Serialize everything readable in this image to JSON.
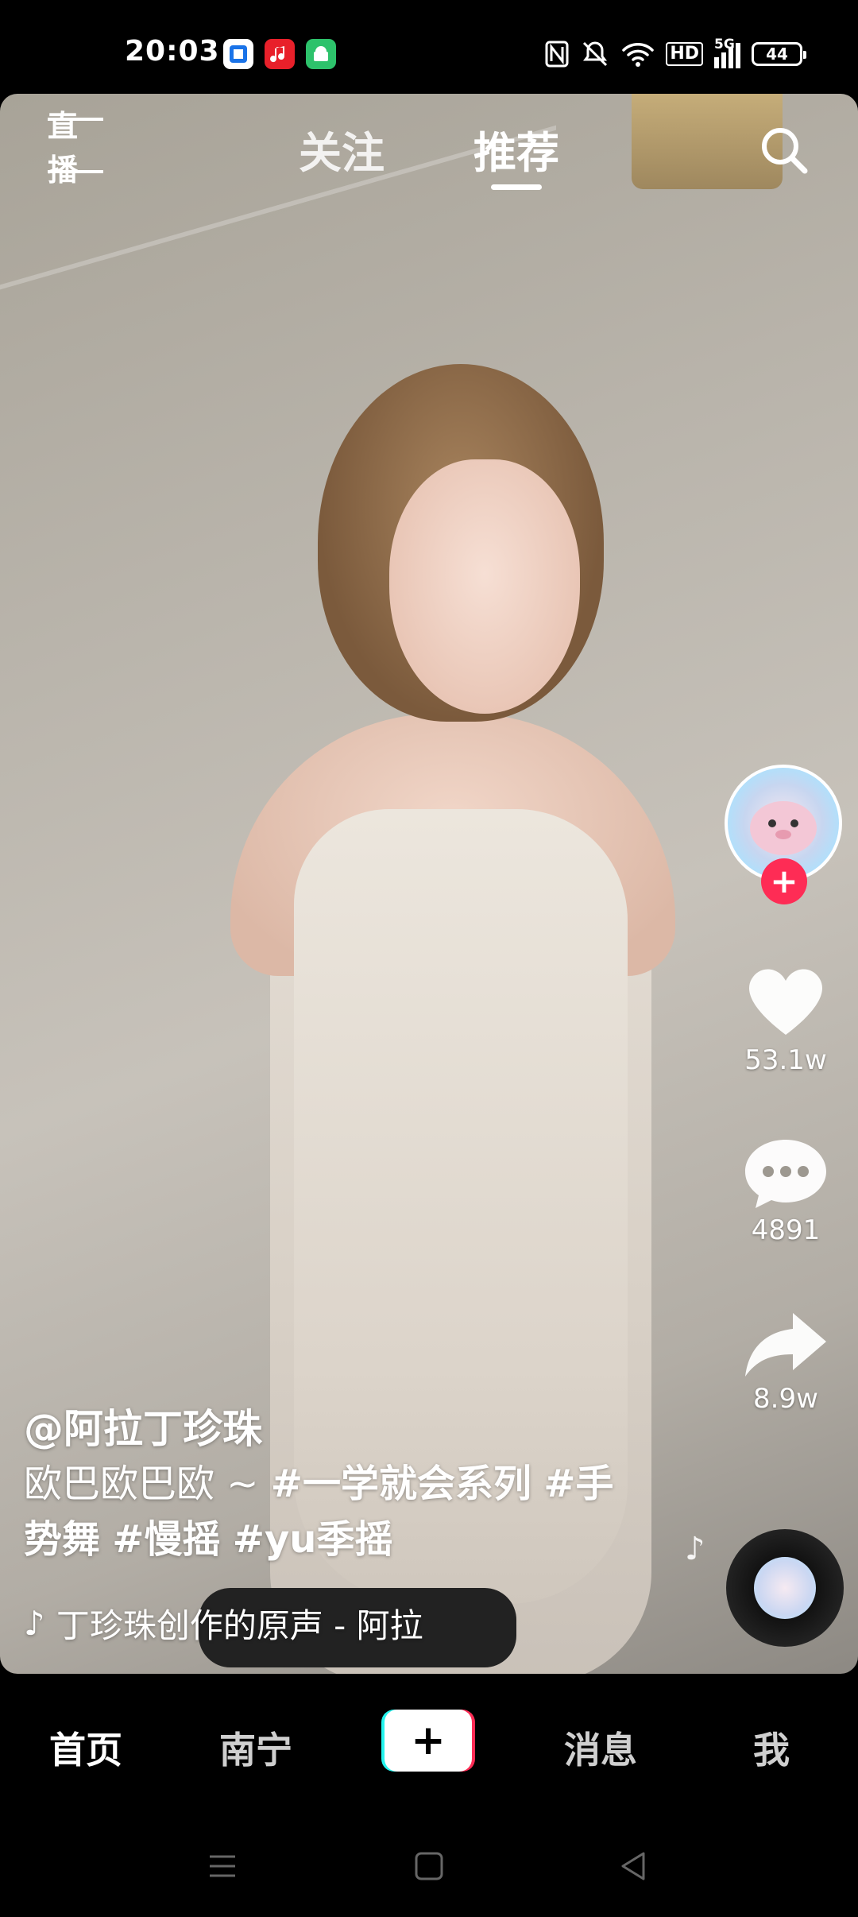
{
  "status_bar": {
    "time": "20:03",
    "network": "5G",
    "hd": "HD",
    "battery": "44",
    "icons": [
      "nfc-icon",
      "silent-bell-icon",
      "wifi-icon",
      "signal-icon"
    ]
  },
  "top_nav": {
    "live_label": "直播",
    "tabs": [
      {
        "label": "关注",
        "active": false
      },
      {
        "label": "推荐",
        "active": true
      }
    ]
  },
  "video": {
    "author": "@阿拉丁珍珠",
    "description_prefix": "欧巴欧巴欧 ~ ",
    "hashtags": [
      "#一学就会系列",
      "#手势舞",
      "#慢摇",
      "#yu季摇"
    ],
    "sound": "丁珍珠创作的原声 - 阿拉"
  },
  "actions": {
    "likes": "53.1w",
    "comments": "4891",
    "shares": "8.9w"
  },
  "bottom_nav": {
    "items": [
      {
        "label": "首页",
        "active": true
      },
      {
        "label": "南宁",
        "active": false
      },
      {
        "label": "+",
        "active": false
      },
      {
        "label": "消息",
        "active": false
      },
      {
        "label": "我",
        "active": false
      }
    ]
  },
  "colors": {
    "accent_red": "#fe2c55",
    "accent_cyan": "#25f4ee"
  }
}
